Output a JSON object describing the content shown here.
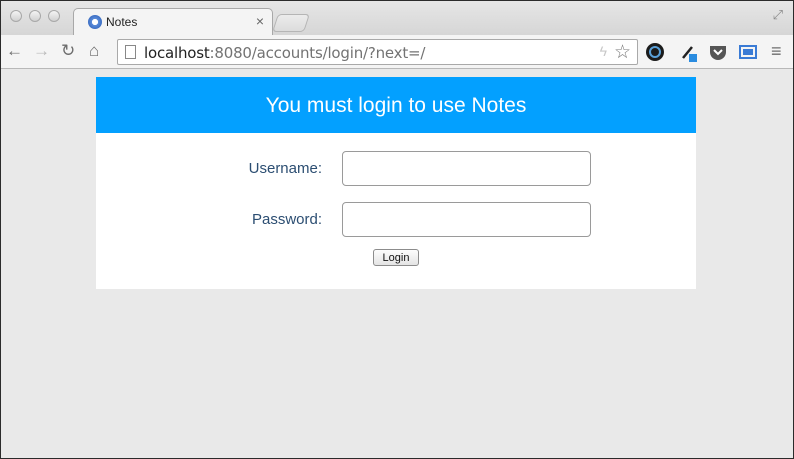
{
  "browser": {
    "tab": {
      "title": "Notes",
      "close_glyph": "×"
    },
    "url": {
      "host": "localhost",
      "rest": ":8080/accounts/login/?next=/"
    },
    "icons": [
      "back-icon",
      "forward-icon",
      "reload-icon",
      "home-icon",
      "page-icon",
      "bolt-icon",
      "star-icon",
      "extension-icon",
      "eyedropper-icon",
      "pocket-icon",
      "cast-icon",
      "menu-icon",
      "fullscreen-icon"
    ]
  },
  "login": {
    "heading": "You must login to use Notes",
    "username_label": "Username:",
    "password_label": "Password:",
    "username_value": "",
    "password_value": "",
    "button_label": "Login"
  },
  "colors": {
    "header_bg": "#03a0ff",
    "label_text": "#2c4e72",
    "page_bg": "#e9e9e9"
  }
}
